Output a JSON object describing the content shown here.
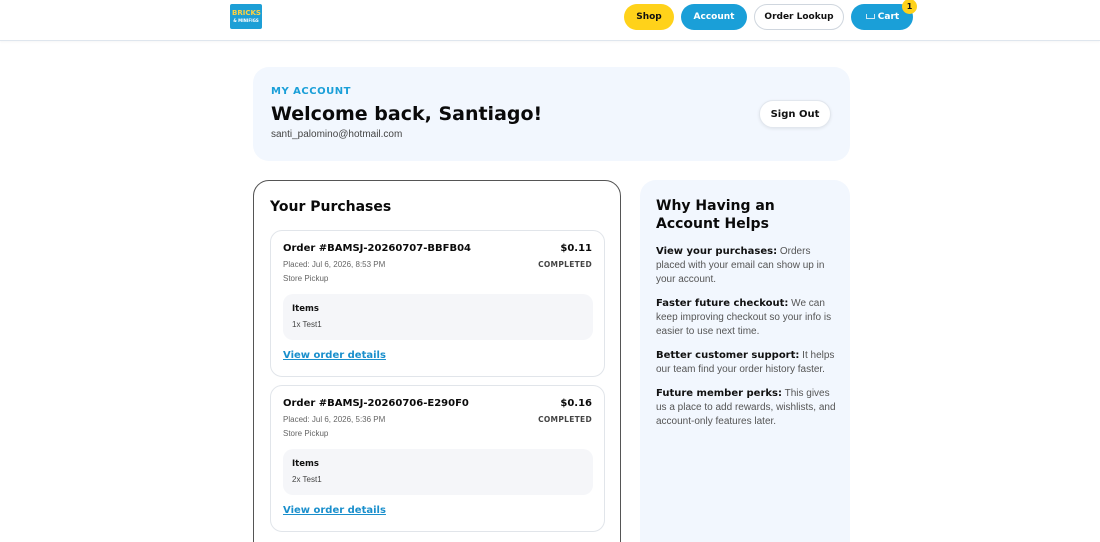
{
  "header": {
    "logo_top": "BRICKS",
    "logo_bottom": "& MINIFIGS",
    "nav": {
      "shop": "Shop",
      "account": "Account",
      "order_lookup": "Order Lookup",
      "cart": "Cart",
      "cart_count": "1"
    }
  },
  "account": {
    "eyebrow": "MY ACCOUNT",
    "welcome": "Welcome back, Santiago!",
    "email": "santi_palomino@hotmail.com",
    "sign_out": "Sign Out"
  },
  "purchases": {
    "title": "Your Purchases",
    "items_label": "Items",
    "details_label": "View order details",
    "orders": [
      {
        "number": "Order #BAMSJ-20260707-BBFB04",
        "total": "$0.11",
        "placed": "Placed: Jul 6, 2026, 8:53 PM",
        "status": "COMPLETED",
        "method": "Store Pickup",
        "items": "1x Test1"
      },
      {
        "number": "Order #BAMSJ-20260706-E290F0",
        "total": "$0.16",
        "placed": "Placed: Jul 6, 2026, 5:36 PM",
        "status": "COMPLETED",
        "method": "Store Pickup",
        "items": "2x Test1"
      }
    ]
  },
  "why": {
    "title": "Why Having an Account Helps",
    "items": [
      {
        "heading": "View your purchases:",
        "text": " Orders placed with your email can show up in your account."
      },
      {
        "heading": "Faster future checkout:",
        "text": " We can keep improving checkout so your info is easier to use next time."
      },
      {
        "heading": "Better customer support:",
        "text": " It helps our team find your order history faster."
      },
      {
        "heading": "Future member perks:",
        "text": " This gives us a place to add rewards, wishlists, and account-only features later."
      }
    ]
  },
  "colors": {
    "brand_blue": "#1a9fd8",
    "brand_yellow": "#ffd21a",
    "panel_bg": "#f2f7fe"
  }
}
